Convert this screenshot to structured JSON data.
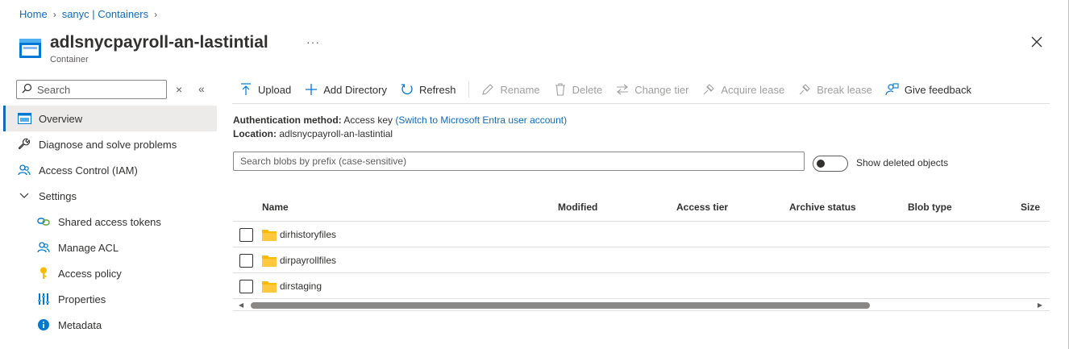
{
  "breadcrumb": {
    "home": "Home",
    "parent": "sanyc | Containers"
  },
  "header": {
    "title": "adlsnycpayroll-an-lastintial",
    "subtitle": "Container",
    "more": "···"
  },
  "nav": {
    "search_placeholder": "Search",
    "items": [
      {
        "label": "Overview",
        "icon": "overview-icon",
        "active": true
      },
      {
        "label": "Diagnose and solve problems",
        "icon": "wrench-icon"
      },
      {
        "label": "Access Control (IAM)",
        "icon": "people-icon"
      },
      {
        "label": "Settings",
        "icon": "chevron-down-icon"
      },
      {
        "label": "Shared access tokens",
        "icon": "link-icon"
      },
      {
        "label": "Manage ACL",
        "icon": "people-icon"
      },
      {
        "label": "Access policy",
        "icon": "key-icon"
      },
      {
        "label": "Properties",
        "icon": "properties-icon"
      },
      {
        "label": "Metadata",
        "icon": "info-icon"
      }
    ]
  },
  "toolbar": {
    "upload": "Upload",
    "add_directory": "Add Directory",
    "refresh": "Refresh",
    "rename": "Rename",
    "delete": "Delete",
    "change_tier": "Change tier",
    "acquire_lease": "Acquire lease",
    "break_lease": "Break lease",
    "give_feedback": "Give feedback"
  },
  "info": {
    "auth_label": "Authentication method:",
    "auth_value": "Access key",
    "auth_link": "(Switch to Microsoft Entra user account)",
    "location_label": "Location:",
    "location_value": "adlsnycpayroll-an-lastintial"
  },
  "blob_search": {
    "placeholder": "Search blobs by prefix (case-sensitive)"
  },
  "show_deleted": {
    "label": "Show deleted objects",
    "on": false
  },
  "table": {
    "columns": [
      "Name",
      "Modified",
      "Access tier",
      "Archive status",
      "Blob type",
      "Size"
    ],
    "rows": [
      {
        "name": "dirhistoryfiles"
      },
      {
        "name": "dirpayrollfiles"
      },
      {
        "name": "dirstaging"
      }
    ]
  },
  "colors": {
    "accent": "#0f6cbd",
    "folder": "#ffb900"
  }
}
